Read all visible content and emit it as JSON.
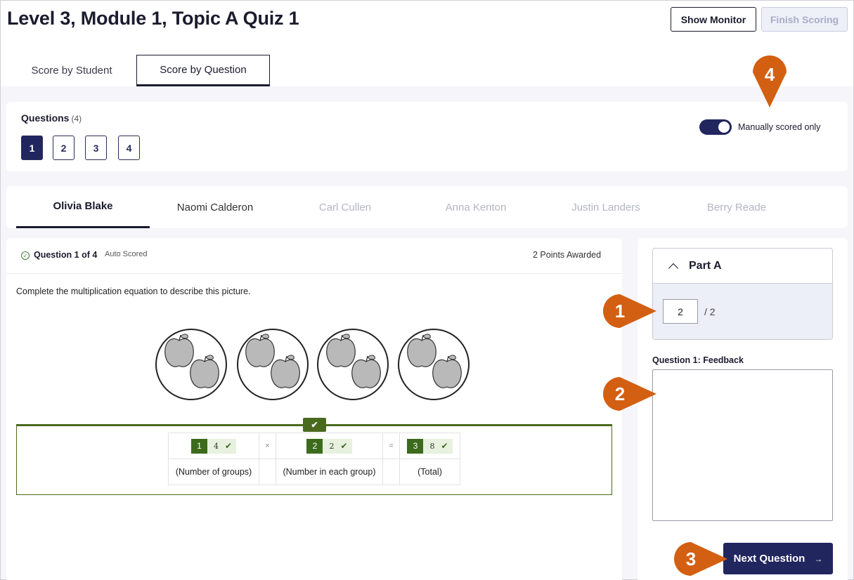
{
  "header": {
    "title": "Level 3, Module 1, Topic A Quiz 1",
    "show_monitor": "Show Monitor",
    "finish_scoring": "Finish Scoring"
  },
  "tabs": [
    {
      "label": "Score by Student",
      "active": false
    },
    {
      "label": "Score by Question",
      "active": true
    }
  ],
  "questions": {
    "title": "Questions",
    "count": "(4)",
    "numbers": [
      "1",
      "2",
      "3",
      "4"
    ],
    "active": "1",
    "toggle_label": "Manually scored only",
    "toggle_on": true
  },
  "students": [
    "Olivia Blake",
    "Naomi Calderon",
    "Carl Cullen",
    "Anna Kenton",
    "Justin Landers",
    "Berry Reade"
  ],
  "question": {
    "label": "Question 1 of 4",
    "scoring": "Auto Scored",
    "points": "2 Points Awarded",
    "prompt": "Complete the multiplication equation to describe this picture.",
    "groups": 4,
    "apples_per_group": 2
  },
  "equation": {
    "answers": [
      {
        "num": "1",
        "value": "4",
        "caption": "(Number of groups)"
      },
      {
        "num": "2",
        "value": "2",
        "caption": "(Number in each group)"
      },
      {
        "num": "3",
        "value": "8",
        "caption": "(Total)"
      }
    ],
    "ops": [
      "×",
      "="
    ]
  },
  "scoring": {
    "part_label": "Part A",
    "score_value": "2",
    "score_max": "/ 2",
    "feedback_label": "Question 1: Feedback",
    "next_label": "Next Question",
    "next_arrow": "→"
  },
  "callouts": [
    "1",
    "2",
    "3",
    "4"
  ],
  "colors": {
    "navy": "#22265e",
    "callout": "#d35f12",
    "correct_green": "#3d6b1c"
  }
}
